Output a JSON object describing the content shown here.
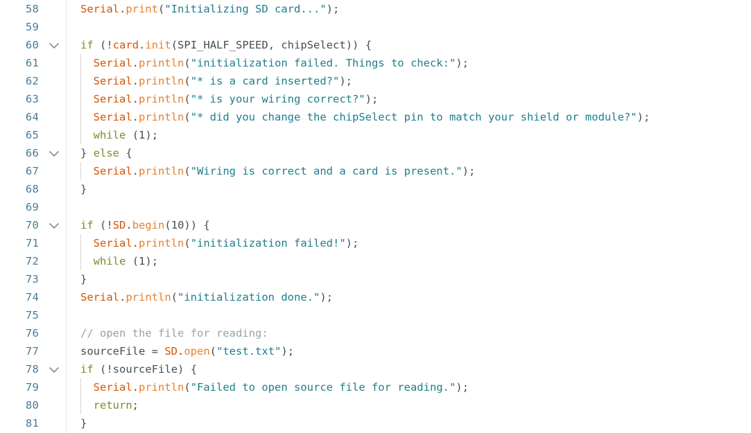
{
  "editor": {
    "name": "arduino-code-editor",
    "language": "arduino-cpp",
    "background_color": "#ffffff",
    "first_visible_line": 58,
    "last_visible_line": 81,
    "line_height_px": 26,
    "colors": {
      "line_number": "#4a7a96",
      "keyword": "#7f8c20",
      "class_name": "#d35400",
      "method": "#e8802a",
      "string": "#1b7e8a",
      "comment": "#95a5a6",
      "plain_text": "#434f54",
      "indent_guide": "#d6d6d6",
      "gutter_separator": "#e8e8e8"
    },
    "icons": {
      "fold_expanded": "chevron-down-icon"
    }
  },
  "lines": [
    {
      "number": "58",
      "foldable": false,
      "indent_guides": 0,
      "raw": "Serial.print(\"Initializing SD card...\");",
      "tokens": [
        {
          "c": "t-class",
          "t": "Serial"
        },
        {
          "c": "t-punct",
          "t": "."
        },
        {
          "c": "t-method",
          "t": "print"
        },
        {
          "c": "t-paren",
          "t": "("
        },
        {
          "c": "t-string",
          "t": "\"Initializing SD card...\""
        },
        {
          "c": "t-paren",
          "t": ")"
        },
        {
          "c": "t-punct",
          "t": ";"
        }
      ]
    },
    {
      "number": "59",
      "foldable": false,
      "indent_guides": 0,
      "raw": "",
      "tokens": []
    },
    {
      "number": "60",
      "foldable": true,
      "indent_guides": 0,
      "raw": "if (!card.init(SPI_HALF_SPEED, chipSelect)) {",
      "tokens": [
        {
          "c": "t-kw",
          "t": "if"
        },
        {
          "c": "t-plain",
          "t": " "
        },
        {
          "c": "t-paren",
          "t": "("
        },
        {
          "c": "t-punct",
          "t": "!"
        },
        {
          "c": "t-class",
          "t": "card"
        },
        {
          "c": "t-punct",
          "t": "."
        },
        {
          "c": "t-method",
          "t": "init"
        },
        {
          "c": "t-paren",
          "t": "("
        },
        {
          "c": "t-plain",
          "t": "SPI_HALF_SPEED, chipSelect"
        },
        {
          "c": "t-paren",
          "t": "))"
        },
        {
          "c": "t-plain",
          "t": " "
        },
        {
          "c": "t-punct",
          "t": "{"
        }
      ]
    },
    {
      "number": "61",
      "foldable": false,
      "indent_guides": 1,
      "raw": "  Serial.println(\"initialization failed. Things to check:\");",
      "tokens": [
        {
          "c": "t-plain",
          "t": "  "
        },
        {
          "c": "t-class",
          "t": "Serial"
        },
        {
          "c": "t-punct",
          "t": "."
        },
        {
          "c": "t-method",
          "t": "println"
        },
        {
          "c": "t-paren",
          "t": "("
        },
        {
          "c": "t-string",
          "t": "\"initialization failed. Things to check:\""
        },
        {
          "c": "t-paren",
          "t": ")"
        },
        {
          "c": "t-punct",
          "t": ";"
        }
      ]
    },
    {
      "number": "62",
      "foldable": false,
      "indent_guides": 1,
      "raw": "  Serial.println(\"* is a card inserted?\");",
      "tokens": [
        {
          "c": "t-plain",
          "t": "  "
        },
        {
          "c": "t-class",
          "t": "Serial"
        },
        {
          "c": "t-punct",
          "t": "."
        },
        {
          "c": "t-method",
          "t": "println"
        },
        {
          "c": "t-paren",
          "t": "("
        },
        {
          "c": "t-string",
          "t": "\"* is a card inserted?\""
        },
        {
          "c": "t-paren",
          "t": ")"
        },
        {
          "c": "t-punct",
          "t": ";"
        }
      ]
    },
    {
      "number": "63",
      "foldable": false,
      "indent_guides": 1,
      "raw": "  Serial.println(\"* is your wiring correct?\");",
      "tokens": [
        {
          "c": "t-plain",
          "t": "  "
        },
        {
          "c": "t-class",
          "t": "Serial"
        },
        {
          "c": "t-punct",
          "t": "."
        },
        {
          "c": "t-method",
          "t": "println"
        },
        {
          "c": "t-paren",
          "t": "("
        },
        {
          "c": "t-string",
          "t": "\"* is your wiring correct?\""
        },
        {
          "c": "t-paren",
          "t": ")"
        },
        {
          "c": "t-punct",
          "t": ";"
        }
      ]
    },
    {
      "number": "64",
      "foldable": false,
      "indent_guides": 1,
      "raw": "  Serial.println(\"* did you change the chipSelect pin to match your shield or module?\");",
      "tokens": [
        {
          "c": "t-plain",
          "t": "  "
        },
        {
          "c": "t-class",
          "t": "Serial"
        },
        {
          "c": "t-punct",
          "t": "."
        },
        {
          "c": "t-method",
          "t": "println"
        },
        {
          "c": "t-paren",
          "t": "("
        },
        {
          "c": "t-string",
          "t": "\"* did you change the chipSelect pin to match your shield or module?\""
        },
        {
          "c": "t-paren",
          "t": ")"
        },
        {
          "c": "t-punct",
          "t": ";"
        }
      ]
    },
    {
      "number": "65",
      "foldable": false,
      "indent_guides": 1,
      "raw": "  while (1);",
      "tokens": [
        {
          "c": "t-plain",
          "t": "  "
        },
        {
          "c": "t-kw",
          "t": "while"
        },
        {
          "c": "t-plain",
          "t": " "
        },
        {
          "c": "t-paren",
          "t": "("
        },
        {
          "c": "t-num",
          "t": "1"
        },
        {
          "c": "t-paren",
          "t": ")"
        },
        {
          "c": "t-punct",
          "t": ";"
        }
      ]
    },
    {
      "number": "66",
      "foldable": true,
      "indent_guides": 0,
      "raw": "} else {",
      "tokens": [
        {
          "c": "t-punct",
          "t": "}"
        },
        {
          "c": "t-plain",
          "t": " "
        },
        {
          "c": "t-kw",
          "t": "else"
        },
        {
          "c": "t-plain",
          "t": " "
        },
        {
          "c": "t-punct",
          "t": "{"
        }
      ]
    },
    {
      "number": "67",
      "foldable": false,
      "indent_guides": 1,
      "raw": "  Serial.println(\"Wiring is correct and a card is present.\");",
      "tokens": [
        {
          "c": "t-plain",
          "t": "  "
        },
        {
          "c": "t-class",
          "t": "Serial"
        },
        {
          "c": "t-punct",
          "t": "."
        },
        {
          "c": "t-method",
          "t": "println"
        },
        {
          "c": "t-paren",
          "t": "("
        },
        {
          "c": "t-string",
          "t": "\"Wiring is correct and a card is present.\""
        },
        {
          "c": "t-paren",
          "t": ")"
        },
        {
          "c": "t-punct",
          "t": ";"
        }
      ]
    },
    {
      "number": "68",
      "foldable": false,
      "indent_guides": 0,
      "raw": "}",
      "tokens": [
        {
          "c": "t-punct",
          "t": "}"
        }
      ]
    },
    {
      "number": "69",
      "foldable": false,
      "indent_guides": 0,
      "raw": "",
      "tokens": []
    },
    {
      "number": "70",
      "foldable": true,
      "indent_guides": 0,
      "raw": "if (!SD.begin(10)) {",
      "tokens": [
        {
          "c": "t-kw",
          "t": "if"
        },
        {
          "c": "t-plain",
          "t": " "
        },
        {
          "c": "t-paren",
          "t": "("
        },
        {
          "c": "t-punct",
          "t": "!"
        },
        {
          "c": "t-class",
          "t": "SD"
        },
        {
          "c": "t-punct",
          "t": "."
        },
        {
          "c": "t-method",
          "t": "begin"
        },
        {
          "c": "t-paren",
          "t": "("
        },
        {
          "c": "t-num",
          "t": "10"
        },
        {
          "c": "t-paren",
          "t": "))"
        },
        {
          "c": "t-plain",
          "t": " "
        },
        {
          "c": "t-punct",
          "t": "{"
        }
      ]
    },
    {
      "number": "71",
      "foldable": false,
      "indent_guides": 1,
      "raw": "  Serial.println(\"initialization failed!\");",
      "tokens": [
        {
          "c": "t-plain",
          "t": "  "
        },
        {
          "c": "t-class",
          "t": "Serial"
        },
        {
          "c": "t-punct",
          "t": "."
        },
        {
          "c": "t-method",
          "t": "println"
        },
        {
          "c": "t-paren",
          "t": "("
        },
        {
          "c": "t-string",
          "t": "\"initialization failed!\""
        },
        {
          "c": "t-paren",
          "t": ")"
        },
        {
          "c": "t-punct",
          "t": ";"
        }
      ]
    },
    {
      "number": "72",
      "foldable": false,
      "indent_guides": 1,
      "raw": "  while (1);",
      "tokens": [
        {
          "c": "t-plain",
          "t": "  "
        },
        {
          "c": "t-kw",
          "t": "while"
        },
        {
          "c": "t-plain",
          "t": " "
        },
        {
          "c": "t-paren",
          "t": "("
        },
        {
          "c": "t-num",
          "t": "1"
        },
        {
          "c": "t-paren",
          "t": ")"
        },
        {
          "c": "t-punct",
          "t": ";"
        }
      ]
    },
    {
      "number": "73",
      "foldable": false,
      "indent_guides": 0,
      "raw": "}",
      "tokens": [
        {
          "c": "t-punct",
          "t": "}"
        }
      ]
    },
    {
      "number": "74",
      "foldable": false,
      "indent_guides": 0,
      "raw": "Serial.println(\"initialization done.\");",
      "tokens": [
        {
          "c": "t-class",
          "t": "Serial"
        },
        {
          "c": "t-punct",
          "t": "."
        },
        {
          "c": "t-method",
          "t": "println"
        },
        {
          "c": "t-paren",
          "t": "("
        },
        {
          "c": "t-string",
          "t": "\"initialization done.\""
        },
        {
          "c": "t-paren",
          "t": ")"
        },
        {
          "c": "t-punct",
          "t": ";"
        }
      ]
    },
    {
      "number": "75",
      "foldable": false,
      "indent_guides": 0,
      "raw": "",
      "tokens": []
    },
    {
      "number": "76",
      "foldable": false,
      "indent_guides": 0,
      "raw": "// open the file for reading:",
      "tokens": [
        {
          "c": "t-comment",
          "t": "// open the file for reading:"
        }
      ]
    },
    {
      "number": "77",
      "foldable": false,
      "indent_guides": 0,
      "raw": "sourceFile = SD.open(\"test.txt\");",
      "tokens": [
        {
          "c": "t-plain",
          "t": "sourceFile = "
        },
        {
          "c": "t-class",
          "t": "SD"
        },
        {
          "c": "t-punct",
          "t": "."
        },
        {
          "c": "t-method",
          "t": "open"
        },
        {
          "c": "t-paren",
          "t": "("
        },
        {
          "c": "t-string",
          "t": "\"test.txt\""
        },
        {
          "c": "t-paren",
          "t": ")"
        },
        {
          "c": "t-punct",
          "t": ";"
        }
      ]
    },
    {
      "number": "78",
      "foldable": true,
      "indent_guides": 0,
      "raw": "if (!sourceFile) {",
      "tokens": [
        {
          "c": "t-kw",
          "t": "if"
        },
        {
          "c": "t-plain",
          "t": " "
        },
        {
          "c": "t-paren",
          "t": "("
        },
        {
          "c": "t-punct",
          "t": "!"
        },
        {
          "c": "t-plain",
          "t": "sourceFile"
        },
        {
          "c": "t-paren",
          "t": ")"
        },
        {
          "c": "t-plain",
          "t": " "
        },
        {
          "c": "t-punct",
          "t": "{"
        }
      ]
    },
    {
      "number": "79",
      "foldable": false,
      "indent_guides": 1,
      "raw": "  Serial.println(\"Failed to open source file for reading.\");",
      "tokens": [
        {
          "c": "t-plain",
          "t": "  "
        },
        {
          "c": "t-class",
          "t": "Serial"
        },
        {
          "c": "t-punct",
          "t": "."
        },
        {
          "c": "t-method",
          "t": "println"
        },
        {
          "c": "t-paren",
          "t": "("
        },
        {
          "c": "t-string",
          "t": "\"Failed to open source file for reading.\""
        },
        {
          "c": "t-paren",
          "t": ")"
        },
        {
          "c": "t-punct",
          "t": ";"
        }
      ]
    },
    {
      "number": "80",
      "foldable": false,
      "indent_guides": 1,
      "raw": "  return;",
      "tokens": [
        {
          "c": "t-plain",
          "t": "  "
        },
        {
          "c": "t-kw",
          "t": "return"
        },
        {
          "c": "t-punct",
          "t": ";"
        }
      ]
    },
    {
      "number": "81",
      "foldable": false,
      "indent_guides": 0,
      "raw": "}",
      "tokens": [
        {
          "c": "t-punct",
          "t": "}"
        }
      ]
    }
  ]
}
